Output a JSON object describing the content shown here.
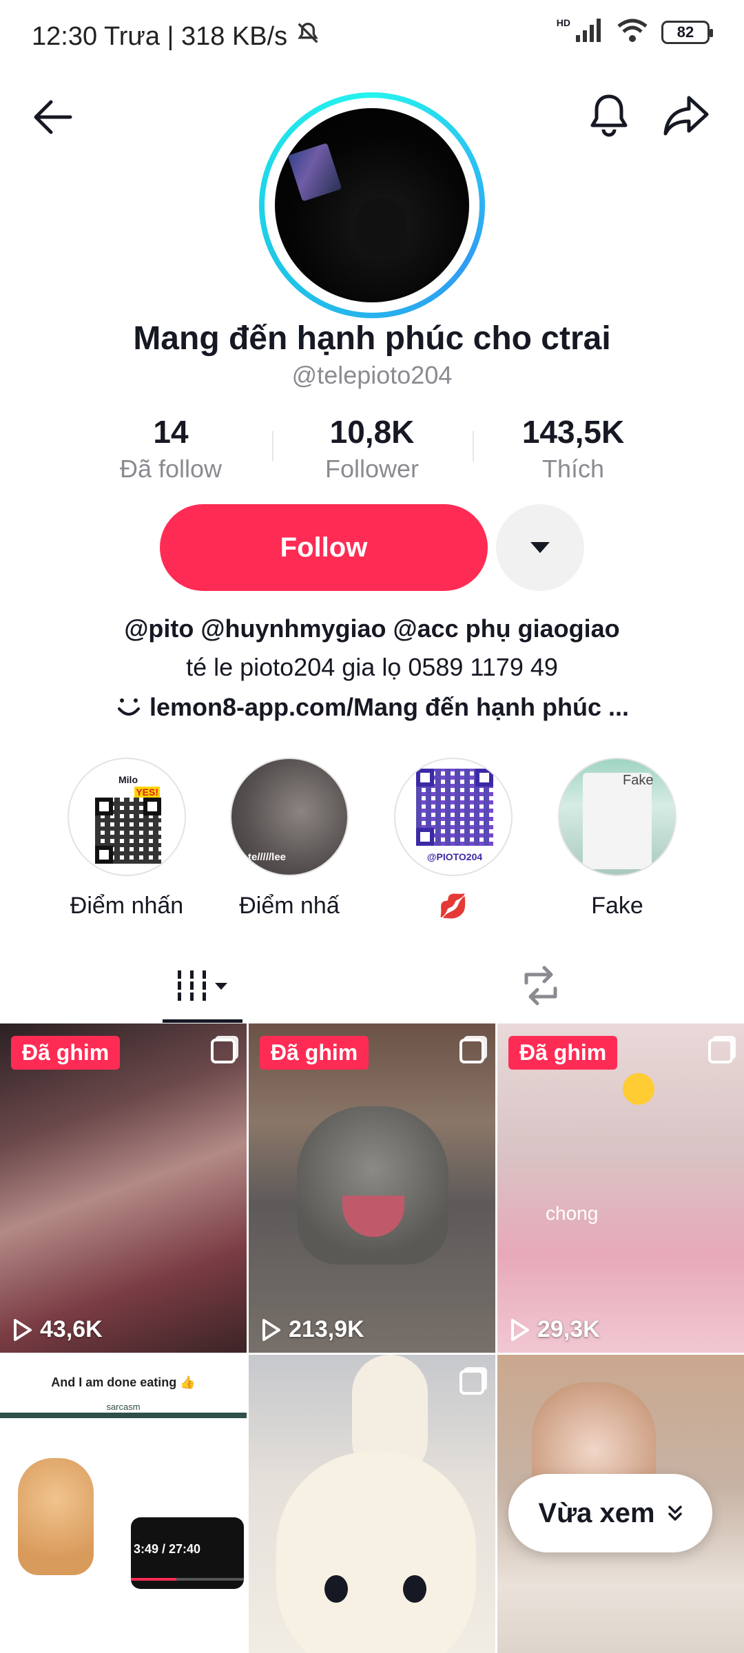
{
  "status_bar": {
    "time_speed": "12:30 Trưa | 318 KB/s",
    "hd": "HD",
    "battery": "82"
  },
  "profile": {
    "display_name": "Mang đến hạnh phúc cho ctrai",
    "handle": "@telepioto204",
    "stats": [
      {
        "value": "14",
        "label": "Đã follow"
      },
      {
        "value": "10,8K",
        "label": "Follower"
      },
      {
        "value": "143,5K",
        "label": "Thích"
      }
    ],
    "follow_label": "Follow",
    "bio_mentions": "@pito  @huynhmygiao @acc phụ giaogiao",
    "bio_text": "té le pioto204 gia lọ 0589 1179 49",
    "bio_link": "lemon8-app.com/Mang đến hạnh phúc ..."
  },
  "highlights": [
    {
      "label": "Điểm nhấn",
      "thumb_text": "Milo",
      "thumb_sub": "YES!"
    },
    {
      "label": "Điểm nhấ",
      "thumb_text": "te/////lee"
    },
    {
      "label": "💋",
      "thumb_text": "@PIOTO204"
    },
    {
      "label": "Fake",
      "thumb_text": "Fake"
    }
  ],
  "videos": [
    {
      "pinned": "Đã ghim",
      "views": "43,6K"
    },
    {
      "pinned": "Đã ghim",
      "views": "213,9K"
    },
    {
      "pinned": "Đã ghim",
      "views": "29,3K",
      "overlay_text": "chong"
    },
    {
      "caption": "And I am done eating 👍",
      "brand": "sarcasm",
      "player_time": "3:49 / 27:40"
    },
    {},
    {}
  ],
  "recently_watched": "Vừa xem",
  "colors": {
    "accent": "#fe2c55",
    "ring": "#25f4ee"
  }
}
